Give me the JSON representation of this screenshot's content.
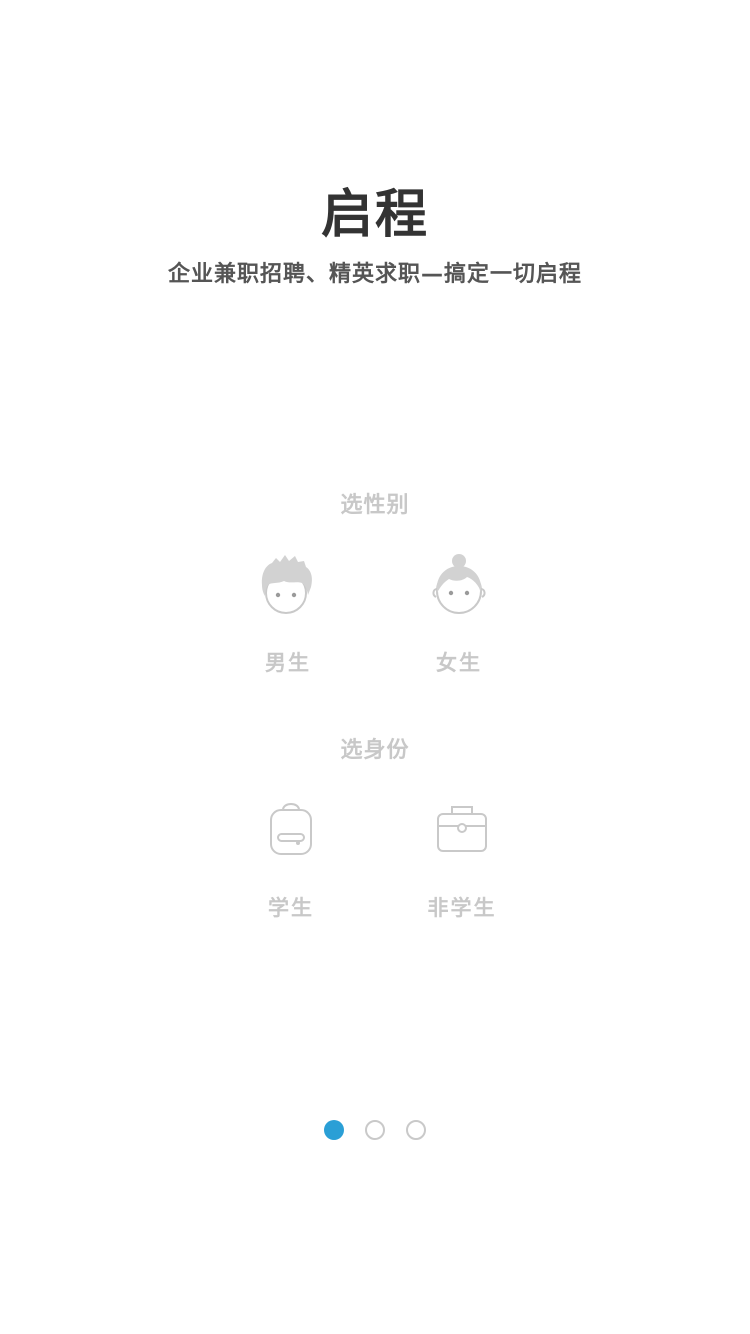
{
  "header": {
    "title": "启程",
    "subtitle": "企业兼职招聘、精英求职—搞定一切启程"
  },
  "gender": {
    "title": "选性别",
    "options": [
      {
        "label": "男生",
        "icon": "boy-face-icon"
      },
      {
        "label": "女生",
        "icon": "girl-face-icon"
      }
    ]
  },
  "identity": {
    "title": "选身份",
    "options": [
      {
        "label": "学生",
        "icon": "backpack-icon"
      },
      {
        "label": "非学生",
        "icon": "briefcase-icon"
      }
    ]
  },
  "pager": {
    "count": 3,
    "active_index": 0
  },
  "colors": {
    "accent": "#2a9fd6",
    "title_text": "#333333",
    "muted_text": "#c8c8c8"
  }
}
